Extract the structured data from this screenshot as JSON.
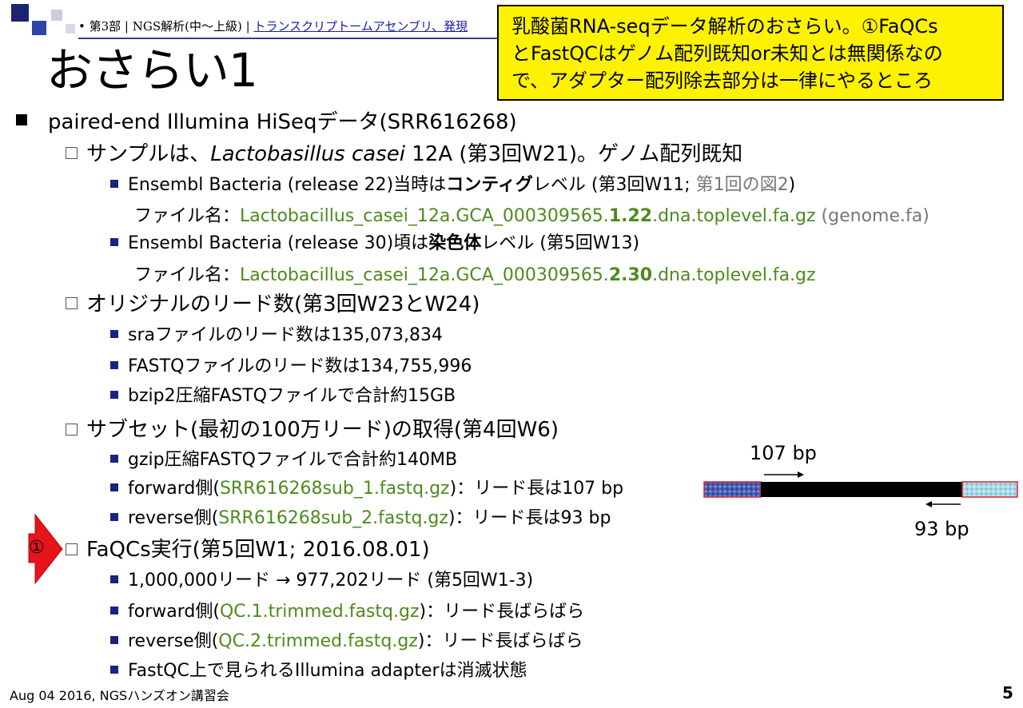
{
  "header": {
    "breadcrumb_prefix": "• 第3部 | NGS解析(中～上級) | ",
    "breadcrumb_link": "トランスクリプトームアセンブリ、発現"
  },
  "title": "おさらい1",
  "callout": {
    "line1": "乳酸菌RNA-seqデータ解析のおさらい。①FaQCs",
    "line2": "とFastQCはゲノム配列既知or未知とは無関係なの",
    "line3": "で、アダプター配列除去部分は一律にやるところ"
  },
  "content": {
    "l1_main": "paired-end Illumina HiSeqデータ(SRR616268)",
    "sample": {
      "prefix": "サンプルは、",
      "species": "Lactobasillus casei",
      "suffix": " 12A (第3回W21)。ゲノム配列既知"
    },
    "ens22": {
      "prefix": "Ensembl Bacteria (release 22)当時は",
      "bold": "コンティグ",
      "suffix": "レベル (第3回W11; ",
      "gray": "第1回の図2",
      "close": ")"
    },
    "file1": {
      "label": "ファイル名：",
      "a": "Lactobacillus_casei_12a.GCA_000309565.",
      "b": "1.22",
      "c": ".dna.toplevel.fa.gz",
      "d": " (genome.fa)"
    },
    "ens30": {
      "prefix": "Ensembl Bacteria (release 30)頃は",
      "bold": "染色体",
      "suffix": "レベル (第5回W13)"
    },
    "file2": {
      "label": "ファイル名：",
      "a": "Lactobacillus_casei_12a.GCA_000309565.",
      "b": "2.30",
      "c": ".dna.toplevel.fa.gz"
    },
    "original_reads": "オリジナルのリード数(第3回W23とW24)",
    "sra_reads": "sraファイルのリード数は135,073,834",
    "fastq_reads": "FASTQファイルのリード数は134,755,996",
    "bzip2": "bzip2圧縮FASTQファイルで合計約15GB",
    "subset": "サブセット(最初の100万リード)の取得(第4回W6)",
    "gzip": "gzip圧縮FASTQファイルで合計約140MB",
    "fwd_sub": {
      "a": "forward側(",
      "file": "SRR616268sub_1.fastq.gz",
      "b": ")：リード長は107 bp"
    },
    "rev_sub": {
      "a": "reverse側(",
      "file": "SRR616268sub_2.fastq.gz",
      "b": ")：リード長は93 bp"
    },
    "faqcs": "FaQCs実行(第5回W1; 2016.08.01)",
    "reads_change": "1,000,000リード → 977,202リード (第5回W1-3)",
    "fwd_qc": {
      "a": "forward側(",
      "file": "QC.1.trimmed.fastq.gz",
      "b": ")：リード長ばらばら"
    },
    "rev_qc": {
      "a": "reverse側(",
      "file": "QC.2.trimmed.fastq.gz",
      "b": ")：リード長ばらばら"
    },
    "fastqc": "FastQC上で見られるIllumina adapterは消滅状態"
  },
  "diagram": {
    "fwd_label": "107 bp",
    "rev_label": "93 bp"
  },
  "marker": {
    "label": "①"
  },
  "footer": {
    "left": "Aug 04 2016, NGSハンズオン講習会",
    "page": "5"
  },
  "colors": {
    "file_green": "#4e8a1d",
    "callout_yellow": "#fff200",
    "arrow_red": "#e8141b",
    "bullet_navy": "#1a237e"
  }
}
